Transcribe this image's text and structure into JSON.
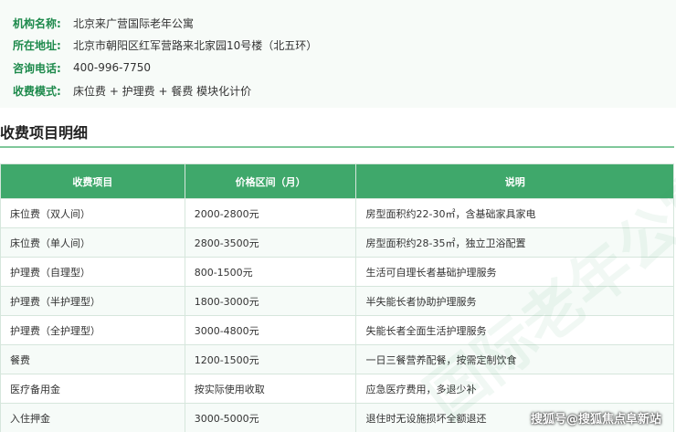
{
  "info": {
    "rows": [
      {
        "label": "机构名称:",
        "value": "北京来广营国际老年公寓"
      },
      {
        "label": "所在地址:",
        "value": "北京市朝阳区红军营路来北家园10号楼（北五环）"
      },
      {
        "label": "咨询电话:",
        "value": "400-996-7750"
      },
      {
        "label": "收费模式:",
        "value": "床位费 + 护理费 + 餐费 模块化计价"
      }
    ]
  },
  "section": {
    "title": "收费项目明细"
  },
  "table": {
    "headers": [
      "收费项目",
      "价格区间（月）",
      "说明"
    ],
    "rows": [
      [
        "床位费（双人间）",
        "2000-2800元",
        "房型面积约22-30㎡，含基础家具家电"
      ],
      [
        "床位费（单人间）",
        "2800-3500元",
        "房型面积约28-35㎡，独立卫浴配置"
      ],
      [
        "护理费（自理型）",
        "800-1500元",
        "生活可自理长者基础护理服务"
      ],
      [
        "护理费（半护理型）",
        "1800-3000元",
        "半失能长者协助护理服务"
      ],
      [
        "护理费（全护理型）",
        "3000-4800元",
        "失能长者全面生活护理服务"
      ],
      [
        "餐费",
        "1200-1500元",
        "一日三餐营养配餐，按需定制饮食"
      ],
      [
        "医疗备用金",
        "按实际使用收取",
        "应急医疗费用，多退少补"
      ],
      [
        "入住押金",
        "3000-5000元",
        "退住时无设施损坏全额退还"
      ]
    ]
  },
  "watermark": "国际老年公寓",
  "credit": "搜狐号@搜狐焦点阜新站"
}
